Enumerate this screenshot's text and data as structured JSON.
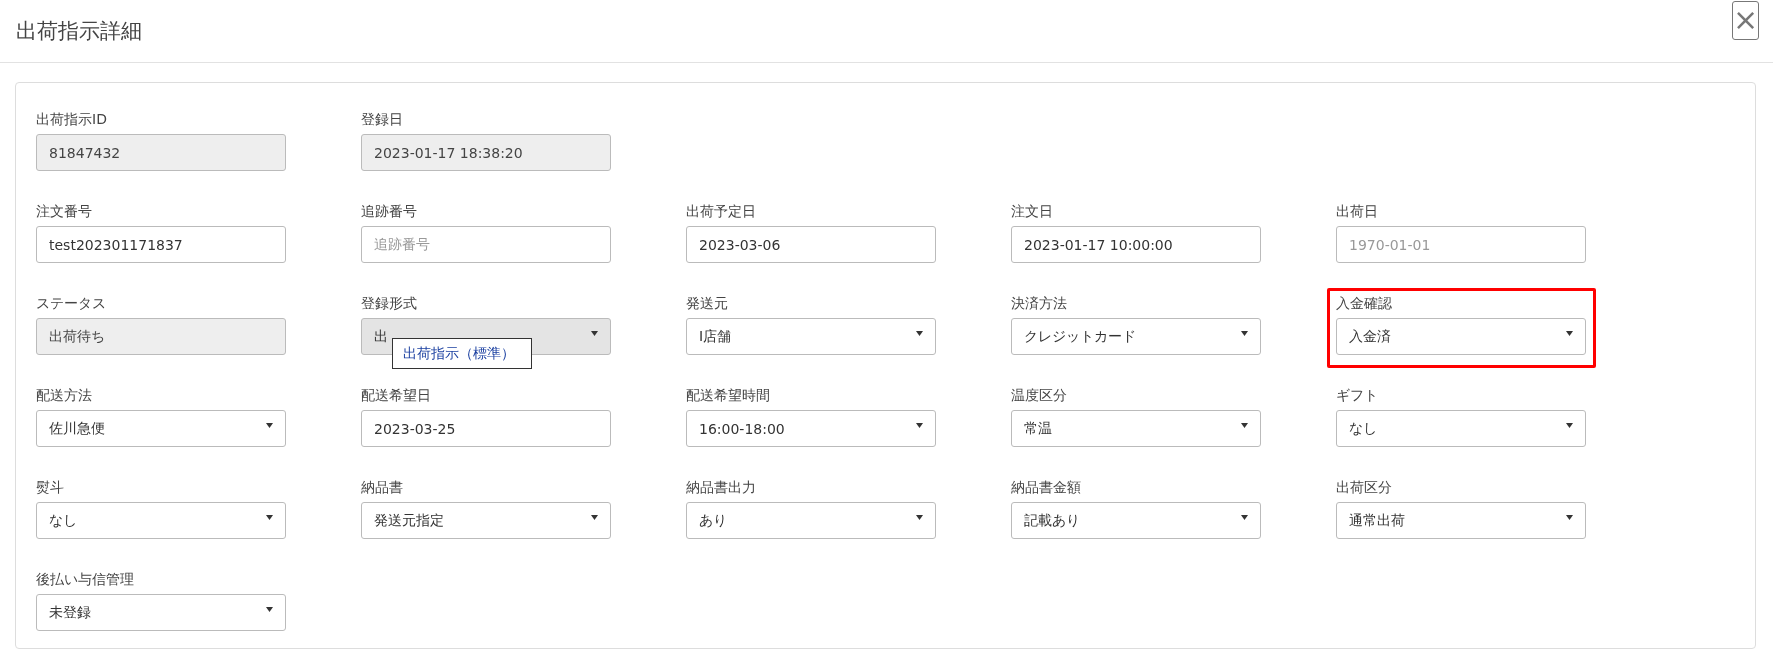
{
  "dialog": {
    "title": "出荷指示詳細",
    "close": "×"
  },
  "fields": [
    {
      "label": "出荷指示ID",
      "kind": "readonly",
      "value": "81847432"
    },
    {
      "label": "登録日",
      "kind": "readonly",
      "value": "2023-01-17 18:38:20"
    },
    {
      "kind": "empty"
    },
    {
      "kind": "empty"
    },
    {
      "kind": "empty"
    },
    {
      "label": "注文番号",
      "kind": "input",
      "value": "test202301171837"
    },
    {
      "label": "追跡番号",
      "kind": "input",
      "placeholder": "追跡番号"
    },
    {
      "label": "出荷予定日",
      "kind": "input",
      "value": "2023-03-06"
    },
    {
      "label": "注文日",
      "kind": "input",
      "value": "2023-01-17 10:00:00"
    },
    {
      "label": "出荷日",
      "kind": "input",
      "placeholder": "1970-01-01"
    },
    {
      "label": "ステータス",
      "kind": "readonly",
      "value": "出荷待ち"
    },
    {
      "label": "登録形式",
      "kind": "select",
      "value": "出",
      "disabled": true,
      "tooltip": "出荷指示（標準）"
    },
    {
      "label": "発送元",
      "kind": "select",
      "value": "I店舗",
      "disabled": false
    },
    {
      "label": "決済方法",
      "kind": "select",
      "value": "クレジットカード",
      "disabled": false
    },
    {
      "label": "入金確認",
      "kind": "select",
      "value": "入金済",
      "disabled": false,
      "highlighted": true
    },
    {
      "label": "配送方法",
      "kind": "select",
      "value": "佐川急便",
      "disabled": false
    },
    {
      "label": "配送希望日",
      "kind": "input",
      "value": "2023-03-25"
    },
    {
      "label": "配送希望時間",
      "kind": "select",
      "value": "16:00-18:00",
      "disabled": false
    },
    {
      "label": "温度区分",
      "kind": "select",
      "value": "常温",
      "disabled": false
    },
    {
      "label": "ギフト",
      "kind": "select",
      "value": "なし",
      "disabled": false
    },
    {
      "label": "熨斗",
      "kind": "select",
      "value": "なし",
      "disabled": false
    },
    {
      "label": "納品書",
      "kind": "select",
      "value": "発送元指定",
      "disabled": false
    },
    {
      "label": "納品書出力",
      "kind": "select",
      "value": "あり",
      "disabled": false
    },
    {
      "label": "納品書金額",
      "kind": "select",
      "value": "記載あり",
      "disabled": false
    },
    {
      "label": "出荷区分",
      "kind": "select",
      "value": "通常出荷",
      "disabled": false
    },
    {
      "label": "後払い与信管理",
      "kind": "select",
      "value": "未登録",
      "disabled": false
    }
  ]
}
